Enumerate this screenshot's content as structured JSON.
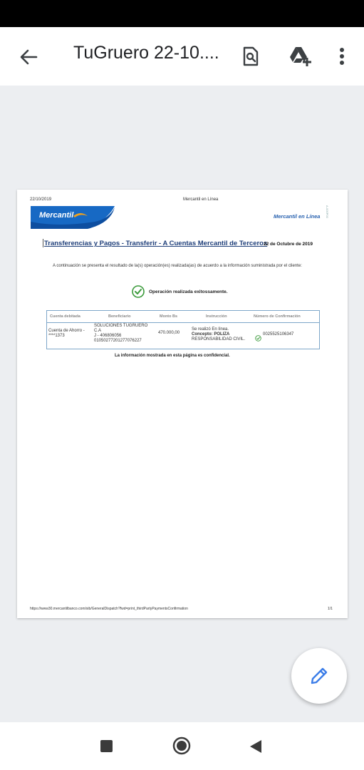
{
  "appbar": {
    "title": "TuGruero 22-10....",
    "icons": [
      "arrow-back-icon",
      "find-in-page-icon",
      "drive-add-icon",
      "more-vert-icon"
    ]
  },
  "document": {
    "header_date": "22/10/2019",
    "header_center": "Mercantil en Línea",
    "side_code": "A-000P00",
    "logo_text": "Mercantil",
    "brand_right": "Mercantil en Línea",
    "section_title": "Transferencias y Pagos - Transferir - A Cuentas Mercantil de Terceros",
    "section_date": "22 de Octubre de 2019",
    "intro": "A continuación se presenta el resultado de la(s) operación(es) realizada(as) de acuerdo a la información suministrada por el cliente:",
    "status": "Operación realizada exitossamente.",
    "table": {
      "headers": [
        "Cuenta debitada",
        "Beneficiario",
        "Monto Bs",
        "Instrucción",
        "Número de Confirmación"
      ],
      "row": {
        "cuenta": [
          "Cuenta de Ahorro -",
          "****1373"
        ],
        "beneficiario": [
          "SOLUCIONES TUGRUERO",
          "C.A",
          "J - 406806056",
          "01050277201277076227"
        ],
        "monto": "470.000,00",
        "instruccion": [
          "Se realizó En línea.",
          "Concepto: POLIZA",
          "RESPONSABILIDAD CIVIL."
        ],
        "confirmacion": "0025525106347"
      }
    },
    "confidential": "La información mostrada en esta página es confidencial.",
    "footer_url": "https://www30.mercantilbanco.com/sib/GeneralDispatch?fwd=print_thirdPartyPaymentsConfirmation",
    "footer_page": "1/1"
  },
  "colors": {
    "accent": "#1f3f7a",
    "logo_blue": "#1769c4",
    "fab_pencil": "#3b7de8",
    "success": "#3a9a3a"
  }
}
